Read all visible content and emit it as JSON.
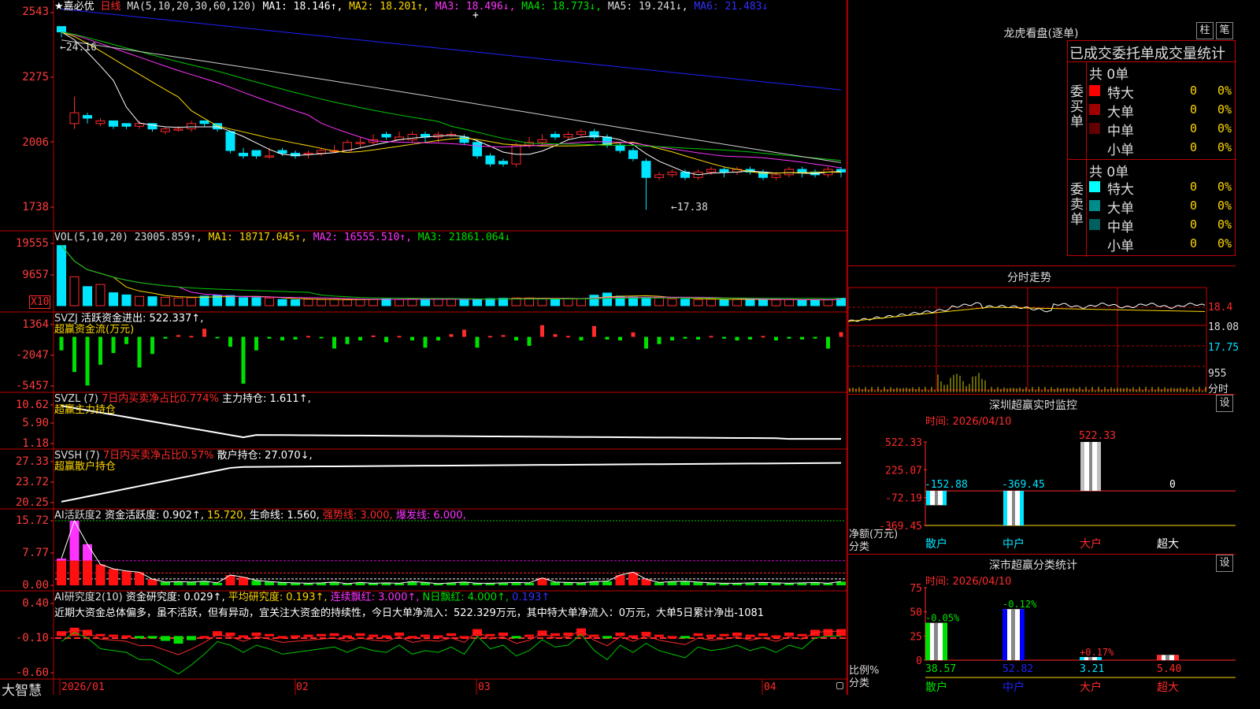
{
  "colors": {
    "up": "#ff2a2a",
    "down": "#00e5ff",
    "ma1": "#ffffff",
    "ma2": "#ffd700",
    "ma3": "#ff33ff",
    "ma4": "#00c800",
    "ma5": "#cfcfcf",
    "ma6": "#2020ff",
    "grid": "#c00000"
  },
  "kline": {
    "header": {
      "name": "★嘉必优",
      "period": "日线",
      "ma_label": "MA(5,10,20,30,60,120)",
      "ma1": "MA1: 18.146↑,",
      "ma2": "MA2: 18.201↑,",
      "ma3": "MA3: 18.496↓,",
      "ma4": "MA4: 18.773↓,",
      "ma5": "MA5: 19.241↓,",
      "ma6": "MA6: 21.483↓"
    },
    "yticks": [
      "2543",
      "2275",
      "2006",
      "1738"
    ],
    "high_mark": "24.16",
    "low_mark": "17.38",
    "candles": [
      [
        24.2,
        24.0,
        24.2,
        23.8
      ],
      [
        20.6,
        21.0,
        21.6,
        20.4
      ],
      [
        20.9,
        20.8,
        21.0,
        20.6
      ],
      [
        20.6,
        20.7,
        20.8,
        20.5
      ],
      [
        20.7,
        20.5,
        20.7,
        20.4
      ],
      [
        20.6,
        20.5,
        20.6,
        20.4
      ],
      [
        20.5,
        20.6,
        20.7,
        20.4
      ],
      [
        20.6,
        20.4,
        20.6,
        20.3
      ],
      [
        20.3,
        20.4,
        20.5,
        20.2
      ],
      [
        20.4,
        20.4,
        20.5,
        20.3
      ],
      [
        20.4,
        20.6,
        20.7,
        20.3
      ],
      [
        20.7,
        20.6,
        20.7,
        20.5
      ],
      [
        20.6,
        20.4,
        20.6,
        20.3
      ],
      [
        20.3,
        19.6,
        20.3,
        19.5
      ],
      [
        19.5,
        19.4,
        19.7,
        19.3
      ],
      [
        19.6,
        19.4,
        19.6,
        19.3
      ],
      [
        19.4,
        19.4,
        19.7,
        19.3
      ],
      [
        19.6,
        19.5,
        19.7,
        19.4
      ],
      [
        19.5,
        19.4,
        19.6,
        19.3
      ],
      [
        19.5,
        19.5,
        19.6,
        19.3
      ],
      [
        19.5,
        19.6,
        19.7,
        19.4
      ],
      [
        19.6,
        19.6,
        19.8,
        19.5
      ],
      [
        19.6,
        19.9,
        20.0,
        19.6
      ],
      [
        19.9,
        19.9,
        20.1,
        19.7
      ],
      [
        19.9,
        20.0,
        20.2,
        19.8
      ],
      [
        20.2,
        20.1,
        20.3,
        20.0
      ],
      [
        20.0,
        20.1,
        20.3,
        20.0
      ],
      [
        20.0,
        20.2,
        20.3,
        19.9
      ],
      [
        20.2,
        20.1,
        20.3,
        19.9
      ],
      [
        20.1,
        20.2,
        20.3,
        19.9
      ],
      [
        20.2,
        20.2,
        20.3,
        20.1
      ],
      [
        20.1,
        19.9,
        20.2,
        19.8
      ],
      [
        19.9,
        19.4,
        20.0,
        19.3
      ],
      [
        19.4,
        19.1,
        19.5,
        19.0
      ],
      [
        19.2,
        19.1,
        19.3,
        19.0
      ],
      [
        19.1,
        19.8,
        19.9,
        19.0
      ],
      [
        19.8,
        19.9,
        20.1,
        19.7
      ],
      [
        19.9,
        20.0,
        20.2,
        19.8
      ],
      [
        20.2,
        20.1,
        20.3,
        20.0
      ],
      [
        20.1,
        20.2,
        20.3,
        20.0
      ],
      [
        20.2,
        20.3,
        20.4,
        20.1
      ],
      [
        20.3,
        20.1,
        20.4,
        20.0
      ],
      [
        20.1,
        19.8,
        20.2,
        19.7
      ],
      [
        19.8,
        19.6,
        19.9,
        19.5
      ],
      [
        19.6,
        19.3,
        19.7,
        19.2
      ],
      [
        19.2,
        18.6,
        19.3,
        17.4
      ],
      [
        18.6,
        18.7,
        18.8,
        18.5
      ],
      [
        18.7,
        18.8,
        18.9,
        18.6
      ],
      [
        18.8,
        18.6,
        18.9,
        18.5
      ],
      [
        18.6,
        18.8,
        18.9,
        18.5
      ],
      [
        18.8,
        18.9,
        19.0,
        18.7
      ],
      [
        18.9,
        18.8,
        19.0,
        18.6
      ],
      [
        18.8,
        18.9,
        19.0,
        18.7
      ],
      [
        18.9,
        18.8,
        19.0,
        18.7
      ],
      [
        18.8,
        18.6,
        18.9,
        18.5
      ],
      [
        18.6,
        18.7,
        18.8,
        18.5
      ],
      [
        18.7,
        18.9,
        19.0,
        18.6
      ],
      [
        18.9,
        18.8,
        19.0,
        18.6
      ],
      [
        18.8,
        18.7,
        18.9,
        18.6
      ],
      [
        18.7,
        18.9,
        19.0,
        18.6
      ],
      [
        18.9,
        18.8,
        19.0,
        18.6
      ]
    ]
  },
  "vol": {
    "header": {
      "label": "VOL(5,10,20)",
      "value": "23005.859↑,",
      "ma1": "MA1: 18717.045↑,",
      "ma2": "MA2: 16555.510↑,",
      "ma3": "MA3: 21861.064↓"
    },
    "yticks": [
      "19555",
      "9657"
    ],
    "unit": "X10",
    "values": [
      19555,
      9400,
      6200,
      6900,
      4200,
      3500,
      3000,
      2900,
      2700,
      2500,
      2600,
      3100,
      3400,
      3300,
      2600,
      2600,
      2500,
      2000,
      1900,
      2100,
      2000,
      2100,
      1900,
      2000,
      2100,
      2200,
      2000,
      2200,
      2100,
      2300,
      2100,
      2000,
      2100,
      2300,
      2400,
      2500,
      2500,
      2300,
      2200,
      2300,
      2300,
      3400,
      4100,
      3100,
      2800,
      2700,
      2500,
      2200,
      2100,
      2000,
      2100,
      2000,
      2100,
      2000,
      1900,
      1900,
      2000,
      1800,
      1900,
      1900,
      2400
    ]
  },
  "svzj": {
    "header": {
      "label": "SVZJ",
      "text": "活跃资金进出: 522.337↑,",
      "sub": "超赢资金流(万元)"
    },
    "yticks": [
      "1364",
      "-2047",
      "-5457"
    ],
    "values": [
      -1500,
      -3900,
      -5400,
      -3100,
      -1800,
      -800,
      -3400,
      -1900,
      -200,
      200,
      100,
      900,
      -100,
      -1100,
      -5200,
      -1500,
      -200,
      -400,
      -300,
      100,
      -100,
      -1300,
      -800,
      -400,
      150,
      -600,
      100,
      -400,
      -1200,
      -400,
      300,
      800,
      -1200,
      100,
      200,
      -400,
      -1000,
      1300,
      300,
      100,
      -400,
      1200,
      -300,
      -400,
      500,
      -1300,
      -800,
      -400,
      -200,
      -300,
      100,
      -200,
      -400,
      -300,
      100,
      -400,
      -200,
      -300,
      -200,
      -1300,
      522
    ]
  },
  "svzl": {
    "header": {
      "label": "SVZL (7)",
      "text1": "7日内买卖净占比0.774%",
      "text2": "主力持仓: 1.611↑,",
      "sub": "超赢主力持仓"
    },
    "yticks": [
      "10.62",
      "5.90",
      "1.18"
    ]
  },
  "svsh": {
    "header": {
      "label": "SVSH (7)",
      "text1": "7日内买卖净占比0.57%",
      "text2": "散户持仓: 27.070↓,",
      "sub": "超赢散户持仓"
    },
    "yticks": [
      "27.33",
      "23.72",
      "20.25"
    ]
  },
  "ai1": {
    "header": {
      "label": "AI活跃度2",
      "text1": "资金活跃度: 0.902↑,",
      "text2": "15.720,",
      "text3": "生命线: 1.560,",
      "text4": "强势线: 3.000,",
      "text5": "爆发线: 6.000,"
    },
    "yticks": [
      "15.72",
      "7.77",
      "0.00"
    ],
    "values": [
      6.5,
      15.72,
      10.0,
      5.1,
      4.0,
      3.5,
      3.2,
      1.5,
      0.8,
      0.9,
      0.8,
      1.0,
      0.6,
      2.5,
      2.0,
      1.2,
      0.9,
      0.7,
      0.6,
      0.5,
      0.6,
      0.8,
      0.4,
      0.7,
      0.5,
      0.6,
      0.5,
      0.9,
      0.7,
      0.4,
      0.6,
      0.8,
      0.5,
      0.5,
      0.6,
      0.7,
      0.6,
      1.8,
      0.8,
      0.7,
      0.6,
      0.9,
      1.0,
      2.5,
      3.2,
      1.5,
      0.7,
      0.9,
      1.0,
      0.8,
      0.6,
      0.5,
      0.5,
      0.6,
      0.7,
      0.6,
      0.5,
      0.6,
      0.7,
      0.5,
      0.9
    ]
  },
  "ai2": {
    "header": {
      "label": "AI研究度2(10)",
      "text1": "资金研究度: 0.029↑,",
      "text2": "平均研究度: 0.193↑,",
      "text3": "连续飘红: 3.000↑,",
      "text4": "N日飘红: 4.000↑,",
      "text5": "0.193↑"
    },
    "comment": "近期大资金总体偏多，虽不活跃，但有异动，宜关注大资金的持续性，今日大单净流入：522.329万元，其中特大单净流入：0万元，大单5日累计净出-1081",
    "yticks": [
      "0.40",
      "-0.10",
      "-0.60"
    ],
    "values": [
      0.0,
      0.05,
      0.02,
      -0.04,
      -0.05,
      -0.06,
      -0.1,
      -0.1,
      -0.14,
      -0.18,
      -0.13,
      -0.07,
      0.0,
      -0.02,
      -0.06,
      -0.02,
      -0.04,
      -0.07,
      -0.06,
      -0.05,
      -0.04,
      -0.03,
      -0.06,
      -0.03,
      -0.05,
      -0.06,
      -0.02,
      -0.07,
      -0.05,
      -0.06,
      -0.03,
      -0.07,
      0.03,
      -0.04,
      -0.02,
      -0.08,
      -0.05,
      0.01,
      -0.03,
      -0.02,
      0.04,
      -0.05,
      -0.1,
      -0.02,
      -0.06,
      -0.01,
      -0.05,
      -0.07,
      -0.09,
      -0.03,
      -0.05,
      -0.04,
      -0.02,
      -0.05,
      -0.03,
      -0.06,
      -0.02,
      -0.04,
      0.02,
      0.03,
      0.03
    ]
  },
  "xaxis": {
    "labels": [
      "2026/01",
      "02",
      "03",
      "04"
    ],
    "logo": "大智慧"
  },
  "dragon": {
    "title": "龙虎看盘(逐单)",
    "btn1": "柱",
    "btn2": "笔",
    "header": "已成交委托单成交量统计",
    "buy_label": "委买单",
    "sell_label": "委卖单",
    "buy_total": "共 0单",
    "sell_total": "共 0单",
    "buy_rows": [
      {
        "name": "特大",
        "count": "0",
        "pct": "0%",
        "color": "#ff0000"
      },
      {
        "name": "大单",
        "count": "0",
        "pct": "0%",
        "color": "#a00000"
      },
      {
        "name": "中单",
        "count": "0",
        "pct": "0%",
        "color": "#600000"
      },
      {
        "name": "小单",
        "count": "0",
        "pct": "0%",
        "color": ""
      }
    ],
    "sell_rows": [
      {
        "name": "特大",
        "count": "0",
        "pct": "0%",
        "color": "#00ffff"
      },
      {
        "name": "大单",
        "count": "0",
        "pct": "0%",
        "color": "#008b8b"
      },
      {
        "name": "中单",
        "count": "0",
        "pct": "0%",
        "color": "#006060"
      },
      {
        "name": "小单",
        "count": "0",
        "pct": "0%",
        "color": ""
      }
    ]
  },
  "intraday": {
    "title": "分时走势",
    "yticks": [
      "18.4",
      "18.08",
      "17.75"
    ],
    "vol_label": "955",
    "vol_unit": "分时"
  },
  "monitor": {
    "title": "深圳超赢实时监控",
    "btn": "设",
    "time": "时间: 2026/04/10",
    "yticks": [
      "522.33",
      "225.07",
      "-72.19",
      "-369.45"
    ],
    "ylabel1": "净额(万元)",
    "ylabel2": "分类",
    "chart_data": {
      "type": "bar",
      "categories": [
        "散户",
        "中户",
        "大户",
        "超大"
      ],
      "values": [
        -152.88,
        -369.45,
        522.33,
        0
      ],
      "value_labels": [
        "-152.88",
        "-369.45",
        "522.33",
        "0"
      ]
    }
  },
  "classify": {
    "title": "深市超赢分类统计",
    "btn": "设",
    "time": "时间: 2026/04/10",
    "yticks": [
      "75",
      "50",
      "25",
      "0"
    ],
    "ylabel1": "比例%",
    "ylabel2": "分类",
    "chart_data": {
      "type": "bar",
      "categories": [
        "散户",
        "中户",
        "大户",
        "超大"
      ],
      "values": [
        38.57,
        52.82,
        3.21,
        5.4
      ],
      "top_labels": [
        "-0.05%",
        "-0.12%",
        "+0.17%",
        ""
      ],
      "bottom_labels": [
        "38.57",
        "52.82",
        "3.21",
        "5.40"
      ]
    }
  }
}
